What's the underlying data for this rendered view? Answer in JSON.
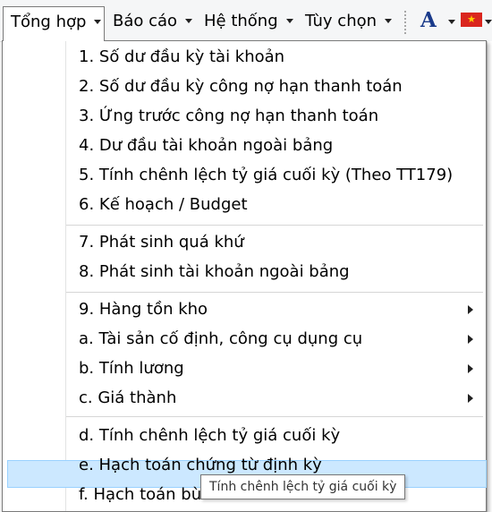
{
  "menubar": {
    "items": [
      {
        "label": "Tổng hợp"
      },
      {
        "label": "Báo cáo"
      },
      {
        "label": "Hệ thống"
      },
      {
        "label": "Tùy chọn"
      }
    ],
    "font_icon_glyph": "A",
    "flag_glyph": "★",
    "font_icon_color": "#1a3a8a",
    "flag_color": "#da251d"
  },
  "dropdown": {
    "items": [
      {
        "label": "1. Số dư đầu kỳ tài khoản"
      },
      {
        "label": "2. Số dư đầu kỳ công nợ hạn thanh toán"
      },
      {
        "label": "3. Ứng trước công nợ hạn thanh toán"
      },
      {
        "label": "4. Dư đầu tài khoản ngoài bảng"
      },
      {
        "label": "5. Tính chênh lệch tỷ giá cuối kỳ (Theo TT179)"
      },
      {
        "label": "6. Kế hoạch / Budget"
      },
      {
        "label": "7. Phát sinh quá khứ"
      },
      {
        "label": "8. Phát sinh tài khoản ngoài bảng"
      },
      {
        "label": "9. Hàng tồn kho",
        "submenu": true
      },
      {
        "label": "a. Tài sản cố định, công cụ dụng cụ",
        "submenu": true
      },
      {
        "label": "b. Tính lương",
        "submenu": true
      },
      {
        "label": "c. Giá thành",
        "submenu": true
      },
      {
        "label": "d. Tính chênh lệch tỷ giá cuối kỳ",
        "highlighted": true
      },
      {
        "label": "e. Hạch toán chứng từ định kỳ"
      },
      {
        "label": "f. Hạch toán bù"
      }
    ],
    "highlight_color": "#cce8ff"
  },
  "tooltip": {
    "text": "Tính chênh lệch tỷ giá cuối kỳ"
  }
}
